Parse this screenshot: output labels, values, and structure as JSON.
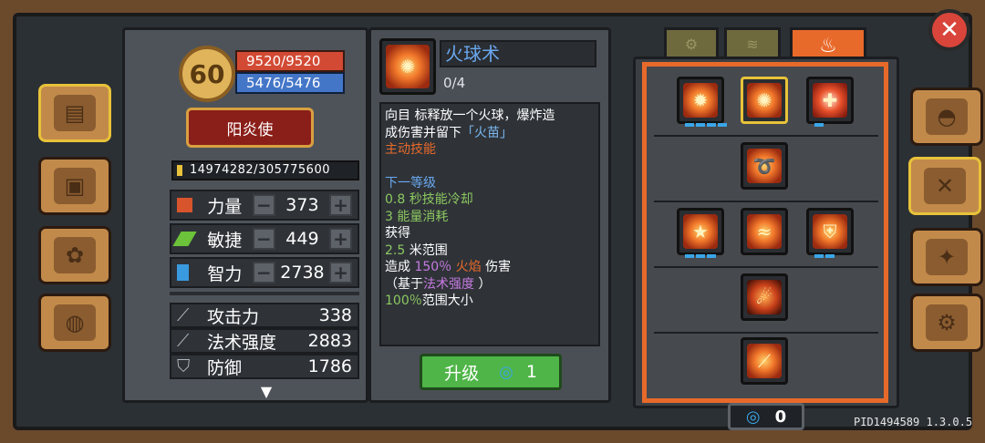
{
  "hero": {
    "level": "60",
    "hp": "9520/9520",
    "mp": "5476/5476",
    "class_name": "阳炎使",
    "exp": "14974282/305775600"
  },
  "stats": [
    {
      "label": "力量",
      "value": "373",
      "icon": "fist-icon",
      "color": "#d8542c"
    },
    {
      "label": "敏捷",
      "value": "449",
      "icon": "leaf-icon",
      "color": "#6cc23a"
    },
    {
      "label": "智力",
      "value": "2738",
      "icon": "book-icon",
      "color": "#3a9ae0"
    }
  ],
  "attributes": [
    {
      "label": "攻击力",
      "value": "338",
      "icon": "sword-icon"
    },
    {
      "label": "法术强度",
      "value": "2883",
      "icon": "wand-icon"
    },
    {
      "label": "防御",
      "value": "1786",
      "icon": "shield-icon"
    }
  ],
  "skill": {
    "name": "火球术",
    "level": "0/4",
    "desc_1": "向目 标释放一个火球，爆炸造",
    "desc_2a": "成伤害并留下",
    "desc_2b": "「火苗」",
    "type": "主动技能",
    "next_level": "下一等级",
    "cooldown_num": "0.8",
    "cooldown_text": "秒技能冷却",
    "energy_num": "3",
    "energy_text": "能量消耗",
    "gain": "获得",
    "range_num": "2.5",
    "range_text": "米范围",
    "damage_pre": "造成",
    "damage_pct": "150％",
    "damage_elem": "火焰",
    "damage_post": "伤害",
    "base_pre": "（基于",
    "base_stat": "法术强度",
    "base_post": "）",
    "aoe_num": "100％",
    "aoe_text": "范围大小",
    "upgrade_label": "升级",
    "upgrade_cost": "1"
  },
  "skill_points": "0",
  "version": "PID1494589 1.3.0.5",
  "colors": {
    "accent_orange": "#e86a2a",
    "gold": "#e8c23a",
    "blue": "#3aa6e8",
    "green": "#4fb548"
  }
}
